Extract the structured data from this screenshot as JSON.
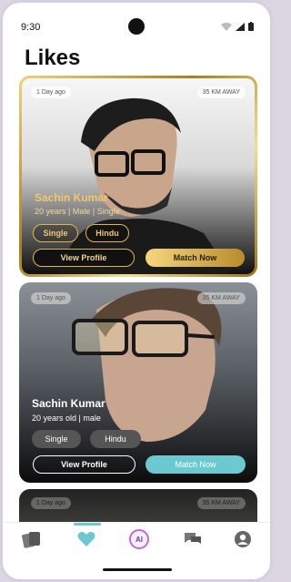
{
  "status": {
    "time": "9:30"
  },
  "page": {
    "title": "Likes"
  },
  "colors": {
    "gold": "#e0b54d",
    "accent": "#6cc9cf"
  },
  "cards": [
    {
      "posted": "1 Day ago",
      "distance": "35 KM AWAY",
      "name": "Sachin Kumar",
      "details": "20 years | Male | Single",
      "tags": [
        "Single",
        "Hindu"
      ],
      "view_label": "View Profile",
      "match_label": "Match Now"
    },
    {
      "posted": "1 Day ago",
      "distance": "35 KM AWAY",
      "name": "Sachin Kumar",
      "details": "20 years old | male",
      "tags": [
        "Single",
        "Hindu"
      ],
      "view_label": "View Profile",
      "match_label": "Match Now"
    },
    {
      "posted": "1 Day ago",
      "distance": "35 KM AWAY"
    }
  ],
  "tabbar": {
    "ai_label": "AI",
    "items": [
      "cards-icon",
      "heart-icon",
      "ai-icon",
      "chat-icon",
      "profile-icon"
    ]
  }
}
